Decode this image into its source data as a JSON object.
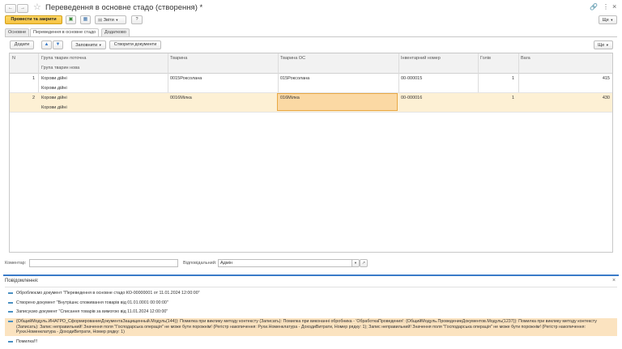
{
  "window": {
    "title": "Переведення в основне стадо (створення) *"
  },
  "toolbar": {
    "post_close": "Провести та закрити",
    "reports": "Звіти",
    "help": "?",
    "more": "Ще"
  },
  "tabs": [
    "Основне",
    "Переведення в основне стадо",
    "Додатково"
  ],
  "table_toolbar": {
    "add": "Додати",
    "fill": "Заповнити",
    "create_docs": "Створити документи",
    "more": "Ще"
  },
  "table": {
    "headers": {
      "n": "N",
      "group_current": "Група тварин поточна",
      "group_new": "Група тварин нова",
      "animal": "Тварина",
      "animal_os": "Тварина ОС",
      "inventory": "Інвентарний номер",
      "heads": "Голів",
      "weight": "Вага"
    },
    "rows": [
      {
        "n": "1",
        "group_current": "Корови дійні",
        "group_new": "Корови дійні",
        "animal": "0015Роксолана",
        "animal_os": "015Роксолана",
        "inventory": "00-000015",
        "heads": "1",
        "weight": "415"
      },
      {
        "n": "2",
        "group_current": "Корови дійні",
        "group_new": "Корови дійні",
        "animal": "0016Мілка",
        "animal_os": "016Мілка",
        "inventory": "00-000016",
        "heads": "1",
        "weight": "430"
      }
    ]
  },
  "footer": {
    "comment_label": "Коментар:",
    "comment_value": "",
    "responsible_label": "Відповідальний:",
    "responsible_value": "Адмін"
  },
  "messages": {
    "title": "Повідомлення:",
    "items": [
      "Оброблюємо документ \"Переведення в основне стадо  КО-00000001 от 11.01.2024 12:00:00\"",
      "Створено документ \"Внутрішнє споживання товарів  від 01.01.0001 00:00:00\"",
      "Записуємо документ \"Списання товарів за вимогою               від 11.01.2024 12:00:00\"",
      "{ОбщийМодуль.ИНАГРО_СформированиеДокументаЗащищенный.Модуль(144)}: Помилка при виклику методу контексту (Записать): Помилка при виконанні обробника - 'ОбработкаПроведения': {ОбщийМодуль.ПроведениеДокументов.Модуль(1237)}: Помилка при виклику методу контексту (Записать): Запис неправильний! Значення поля \"Господарська операція\" не може бути порожнім! (Регістр накопичення: Рухи.Номенклатура - ДоходиВитрати, Номер рядку: 1); Запис неправильний! Значення поля \"Господарська операція\" не може бути порожнім! (Регістр накопичення: Рухи.Номенклатура - ДоходиВитрати, Номер рядку: 1)",
      "Помилка!!!"
    ]
  },
  "colors": {
    "accent": "#f5c242",
    "selected_row": "#fdf0d4",
    "selected_cell": "#fbd9a4",
    "error_bg": "#fbe3c0"
  }
}
